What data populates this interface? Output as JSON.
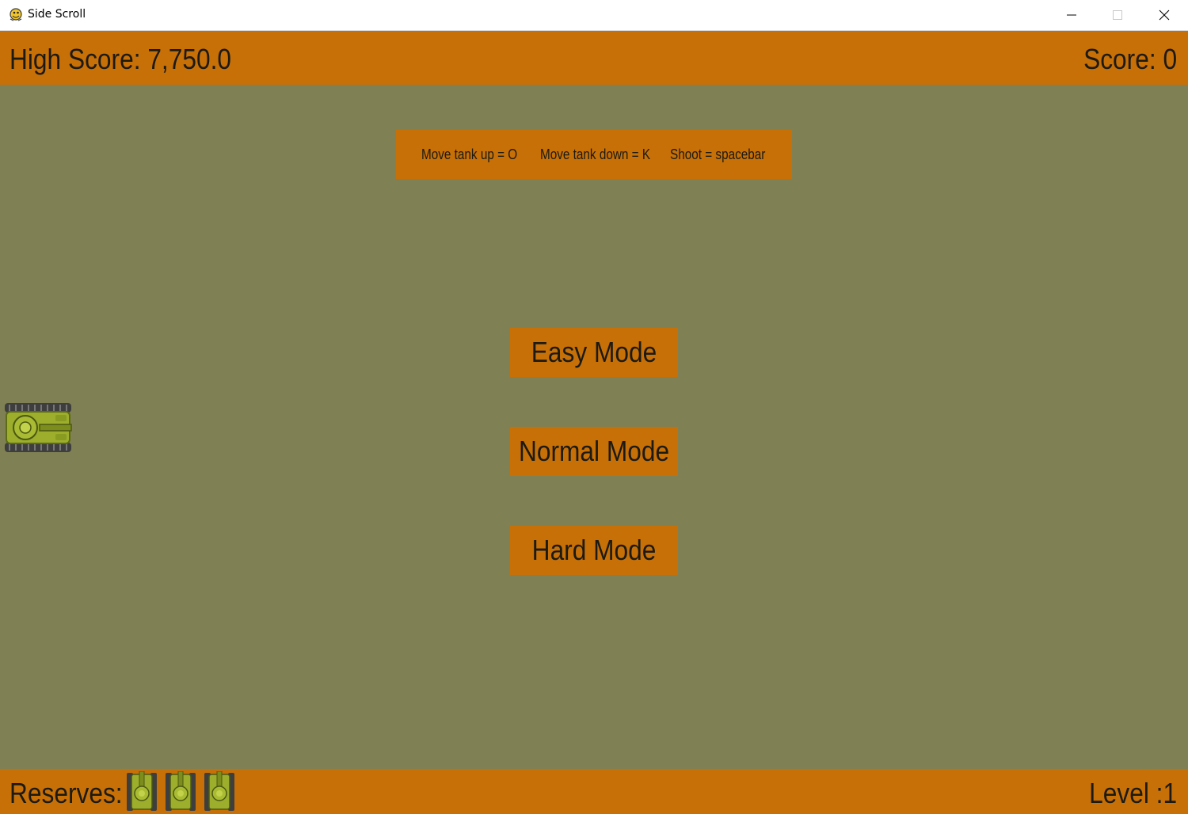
{
  "window": {
    "title": "Side Scroll"
  },
  "hud": {
    "high_score_label": "High Score: 7,750.0",
    "score_label": "Score: 0",
    "reserves_label": "Reserves:",
    "reserve_count": 3,
    "level_label": "Level :1"
  },
  "controls": {
    "move_up": "Move tank up = O",
    "move_down": "Move tank down = K",
    "shoot": "Shoot = spacebar"
  },
  "menu": {
    "easy": "Easy Mode",
    "normal": "Normal Mode",
    "hard": "Hard Mode"
  },
  "colors": {
    "hud_bar": "#c77008",
    "playfield": "#7f8053",
    "text": "#1c1a12",
    "tank_body": "#9cae2c",
    "tank_track": "#4a4a4a"
  },
  "icons": {
    "app": "pygame-snake-icon",
    "minimize": "minimize-icon",
    "maximize": "maximize-icon",
    "close": "close-icon",
    "player": "tank-icon",
    "reserve": "reserve-tank-icon"
  }
}
